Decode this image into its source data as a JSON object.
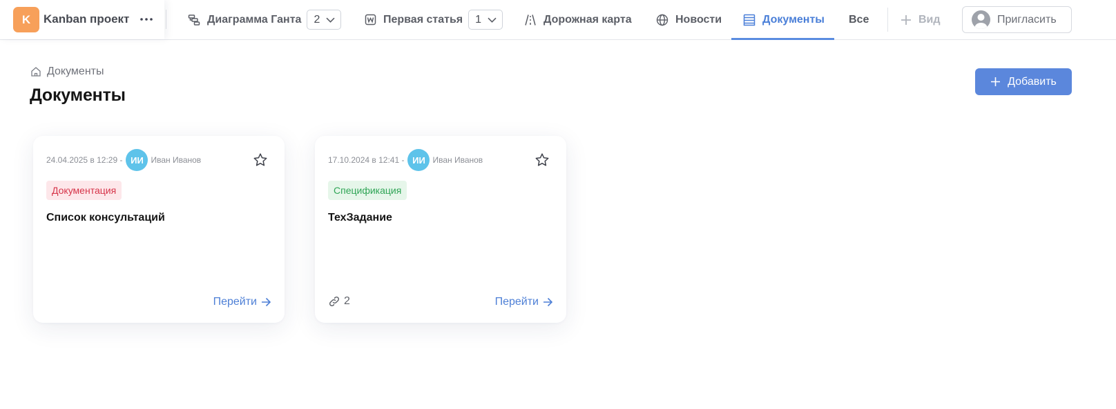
{
  "project": {
    "logo_letter": "K",
    "name": "Kanban проект",
    "logo_color": "#f7a05a"
  },
  "tabs": [
    {
      "label": "Диаграмма Ганта",
      "icon": "gantt-icon",
      "count": "2"
    },
    {
      "label": "Первая статья",
      "icon": "wiki-icon",
      "count": "1"
    },
    {
      "label": "Дорожная карта",
      "icon": "road-icon"
    },
    {
      "label": "Новости",
      "icon": "globe-icon"
    },
    {
      "label": "Документы",
      "icon": "stack-icon",
      "active": true
    }
  ],
  "header_actions": {
    "all_label": "Все",
    "view_label": "Вид",
    "invite_label": "Пригласить"
  },
  "breadcrumb": {
    "label": "Документы",
    "icon": "home-icon"
  },
  "page": {
    "title": "Документы",
    "add_label": "Добавить",
    "accent_color": "#5b87dc"
  },
  "documents": [
    {
      "date": "24.04.2025 в 12:29 -",
      "author_initials": "ИИ",
      "author": "Иван Иванов",
      "tag": "Документация",
      "tag_color": "#d63449",
      "title": "Список консультаций",
      "go_label": "Перейти"
    },
    {
      "date": "17.10.2024 в 12:41 -",
      "author_initials": "ИИ",
      "author": "Иван Иванов",
      "tag": "Спецификация",
      "tag_color": "#2fa556",
      "title": "ТехЗадание",
      "links_count": "2",
      "go_label": "Перейти"
    }
  ]
}
